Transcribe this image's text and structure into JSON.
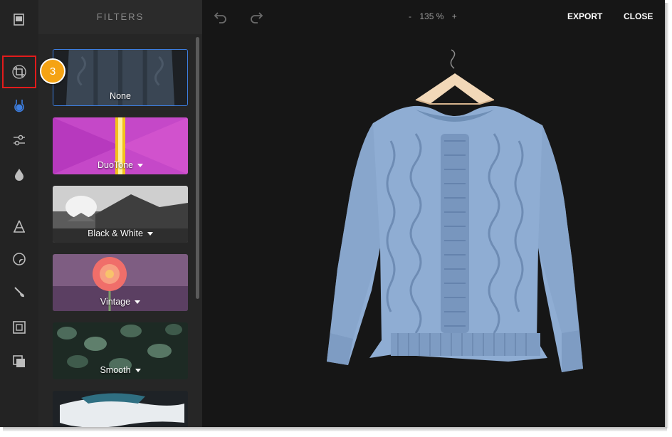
{
  "panel": {
    "title": "FILTERS"
  },
  "filters": [
    {
      "label": "None",
      "has_options": false,
      "selected": true
    },
    {
      "label": "DuoTone",
      "has_options": true,
      "selected": false
    },
    {
      "label": "Black & White",
      "has_options": true,
      "selected": false
    },
    {
      "label": "Vintage",
      "has_options": true,
      "selected": false
    },
    {
      "label": "Smooth",
      "has_options": true,
      "selected": false
    },
    {
      "label": "",
      "has_options": false,
      "selected": false
    }
  ],
  "toolbar": {
    "items": [
      "library-icon",
      "crop-icon",
      "filter-icon",
      "adjust-icon",
      "focus-icon",
      "text-icon",
      "sticker-icon",
      "brush-icon",
      "frame-icon",
      "overlay-icon"
    ],
    "highlighted_item": "crop-icon",
    "active_item": "filter-icon"
  },
  "step_badge": "3",
  "topbar": {
    "zoom_minus": "-",
    "zoom_value": "135 %",
    "zoom_plus": "+",
    "export_label": "EXPORT",
    "close_label": "CLOSE"
  },
  "colors": {
    "accent": "#3d7ee0",
    "highlight_box": "#e21b1b",
    "badge": "#f5a314",
    "canvas_bg": "#161616"
  }
}
